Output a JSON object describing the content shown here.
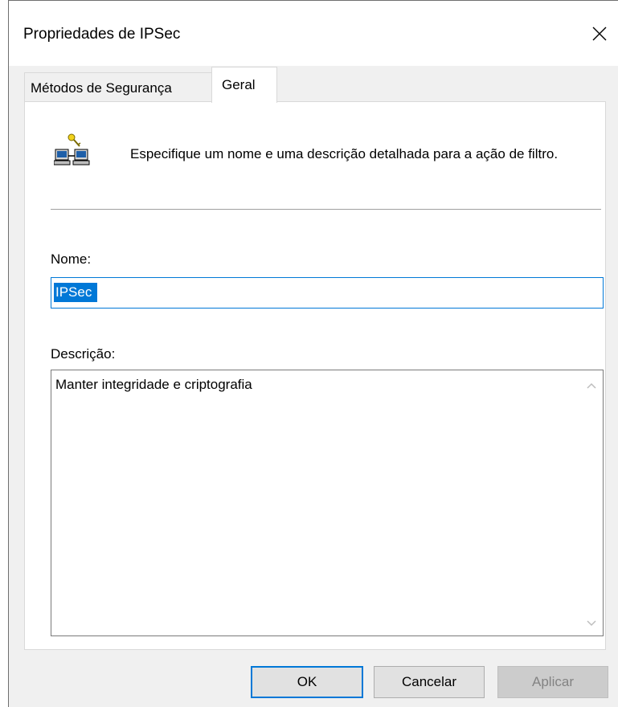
{
  "window": {
    "title": "Propriedades de IPSec",
    "close_icon": "close-icon"
  },
  "tabs": [
    {
      "label": "Métodos de Segurança",
      "selected": false
    },
    {
      "label": "Geral",
      "selected": true
    }
  ],
  "header": {
    "icon": "network-key-icon",
    "description": "Especifique um nome e uma descrição detalhada para a ação de filtro."
  },
  "form": {
    "name_label": "Nome:",
    "name_value": "IPSec",
    "description_label": "Descrição:",
    "description_value": "Manter integridade e criptografia"
  },
  "buttons": {
    "ok": "OK",
    "cancel": "Cancelar",
    "apply": "Aplicar",
    "apply_enabled": false
  },
  "colors": {
    "selection": "#0078d7",
    "dialog_bg": "#f0f0f0",
    "panel_bg": "#ffffff",
    "button_bg": "#e1e1e1",
    "disabled_text": "#838383"
  }
}
